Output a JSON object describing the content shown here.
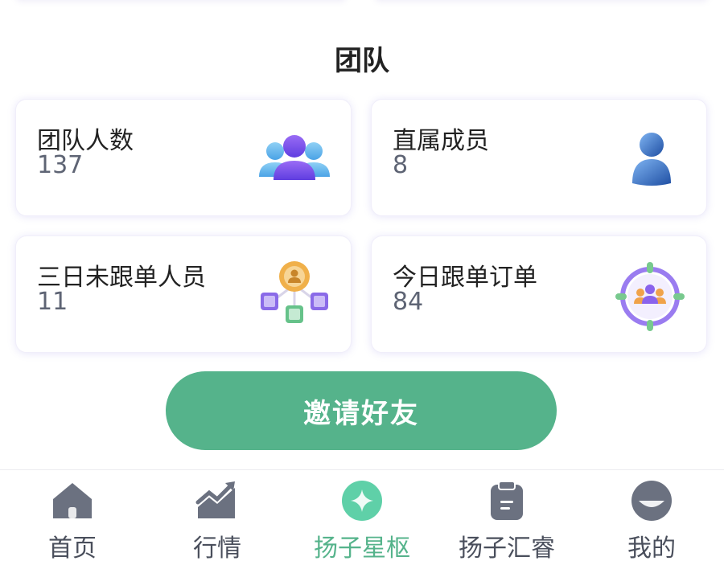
{
  "section": {
    "title": "团队"
  },
  "stats": [
    {
      "label": "团队人数",
      "value": "137",
      "icon": "team-group-icon"
    },
    {
      "label": "直属成员",
      "value": "8",
      "icon": "person-icon"
    },
    {
      "label": "三日未跟单人员",
      "value": "11",
      "icon": "network-people-icon"
    },
    {
      "label": "今日跟单订单",
      "value": "84",
      "icon": "target-people-icon"
    }
  ],
  "invite_button": {
    "label": "邀请好友"
  },
  "tabs": [
    {
      "label": "首页",
      "icon": "home-icon",
      "active": false
    },
    {
      "label": "行情",
      "icon": "chart-trend-icon",
      "active": false
    },
    {
      "label": "扬子星枢",
      "icon": "sparkle-icon",
      "active": true
    },
    {
      "label": "扬子汇睿",
      "icon": "clipboard-icon",
      "active": false
    },
    {
      "label": "我的",
      "icon": "profile-icon",
      "active": false
    }
  ],
  "colors": {
    "accent": "#55b38b",
    "inactive": "#6b7180",
    "card_shadow": "#e8e4fb"
  }
}
